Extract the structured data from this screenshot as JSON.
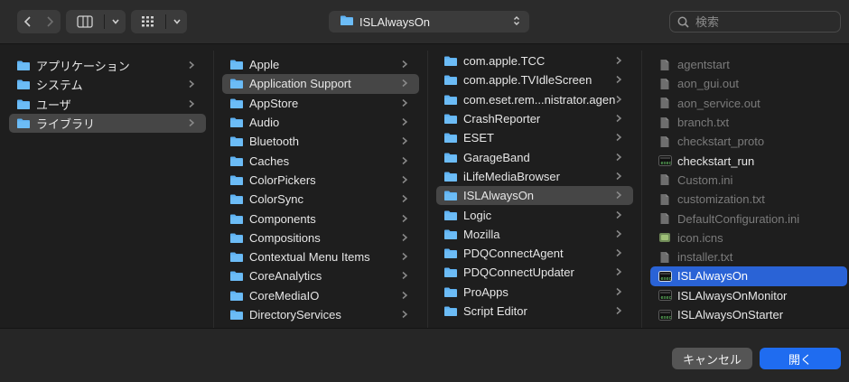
{
  "toolbar": {
    "path_selector": {
      "label": "ISLAlwaysOn"
    },
    "search": {
      "placeholder": "検索",
      "value": ""
    }
  },
  "sidebar_column": {
    "items": [
      {
        "label": "アプリケーション",
        "kind": "folder",
        "state": "normal"
      },
      {
        "label": "システム",
        "kind": "folder",
        "state": "normal"
      },
      {
        "label": "ユーザ",
        "kind": "folder",
        "state": "normal"
      },
      {
        "label": "ライブラリ",
        "kind": "folder",
        "state": "selected-path"
      }
    ]
  },
  "library_column": {
    "items": [
      {
        "label": "Apple",
        "kind": "folder",
        "state": "normal"
      },
      {
        "label": "Application Support",
        "kind": "folder",
        "state": "selected-path"
      },
      {
        "label": "AppStore",
        "kind": "folder",
        "state": "normal"
      },
      {
        "label": "Audio",
        "kind": "folder",
        "state": "normal"
      },
      {
        "label": "Bluetooth",
        "kind": "folder",
        "state": "normal"
      },
      {
        "label": "Caches",
        "kind": "folder",
        "state": "normal"
      },
      {
        "label": "ColorPickers",
        "kind": "folder",
        "state": "normal"
      },
      {
        "label": "ColorSync",
        "kind": "folder",
        "state": "normal"
      },
      {
        "label": "Components",
        "kind": "folder",
        "state": "normal"
      },
      {
        "label": "Compositions",
        "kind": "folder",
        "state": "normal"
      },
      {
        "label": "Contextual Menu Items",
        "kind": "folder",
        "state": "normal"
      },
      {
        "label": "CoreAnalytics",
        "kind": "folder",
        "state": "normal"
      },
      {
        "label": "CoreMediaIO",
        "kind": "folder",
        "state": "normal"
      },
      {
        "label": "DirectoryServices",
        "kind": "folder",
        "state": "normal"
      }
    ]
  },
  "app_support_column": {
    "items": [
      {
        "label": "com.apple.TCC",
        "kind": "folder",
        "state": "normal"
      },
      {
        "label": "com.apple.TVIdleScreen",
        "kind": "folder",
        "state": "normal"
      },
      {
        "label": "com.eset.rem...nistrator.agent",
        "kind": "folder",
        "state": "normal"
      },
      {
        "label": "CrashReporter",
        "kind": "folder",
        "state": "normal"
      },
      {
        "label": "ESET",
        "kind": "folder",
        "state": "normal"
      },
      {
        "label": "GarageBand",
        "kind": "folder",
        "state": "normal"
      },
      {
        "label": "iLifeMediaBrowser",
        "kind": "folder",
        "state": "normal"
      },
      {
        "label": "ISLAlwaysOn",
        "kind": "folder",
        "state": "selected-path"
      },
      {
        "label": "Logic",
        "kind": "folder",
        "state": "normal"
      },
      {
        "label": "Mozilla",
        "kind": "folder",
        "state": "normal"
      },
      {
        "label": "PDQConnectAgent",
        "kind": "folder",
        "state": "normal"
      },
      {
        "label": "PDQConnectUpdater",
        "kind": "folder",
        "state": "normal"
      },
      {
        "label": "ProApps",
        "kind": "folder",
        "state": "normal"
      },
      {
        "label": "Script Editor",
        "kind": "folder",
        "state": "normal"
      }
    ]
  },
  "isl_column": {
    "items": [
      {
        "label": "agentstart",
        "kind": "file",
        "state": "dim"
      },
      {
        "label": "aon_gui.out",
        "kind": "file",
        "state": "dim"
      },
      {
        "label": "aon_service.out",
        "kind": "file",
        "state": "dim"
      },
      {
        "label": "branch.txt",
        "kind": "file",
        "state": "dim"
      },
      {
        "label": "checkstart_proto",
        "kind": "file",
        "state": "dim"
      },
      {
        "label": "checkstart_run",
        "kind": "exec",
        "state": "normal"
      },
      {
        "label": "Custom.ini",
        "kind": "file",
        "state": "dim"
      },
      {
        "label": "customization.txt",
        "kind": "file",
        "state": "dim"
      },
      {
        "label": "DefaultConfiguration.ini",
        "kind": "file",
        "state": "dim"
      },
      {
        "label": "icon.icns",
        "kind": "icns",
        "state": "dim"
      },
      {
        "label": "installer.txt",
        "kind": "file",
        "state": "dim"
      },
      {
        "label": "ISLAlwaysOn",
        "kind": "exec",
        "state": "selected"
      },
      {
        "label": "ISLAlwaysOnMonitor",
        "kind": "exec",
        "state": "normal"
      },
      {
        "label": "ISLAlwaysOnStarter",
        "kind": "exec",
        "state": "normal"
      }
    ]
  },
  "footer": {
    "cancel_label": "キャンセル",
    "open_label": "開く"
  },
  "colors": {
    "folder": "#5fb2f3",
    "selection_blue": "#2a63d6",
    "selection_gray": "#464646",
    "primary_button": "#1f6cf0"
  }
}
